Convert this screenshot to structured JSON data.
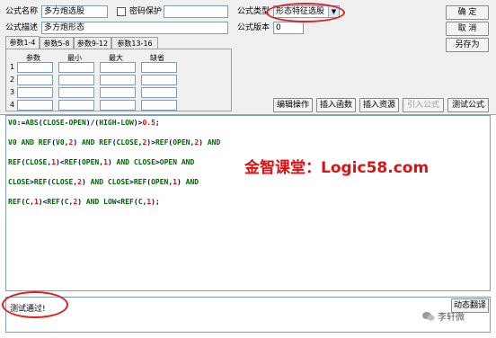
{
  "form": {
    "name_label": "公式名称",
    "name_value": "多方炮选股",
    "password_label": "密码保护",
    "desc_label": "公式描述",
    "desc_value": "多方炮形态",
    "type_label": "公式类型",
    "type_value": "形态特征选股",
    "version_label": "公式版本",
    "version_value": "0"
  },
  "buttons": {
    "ok": "确  定",
    "cancel": "取  消",
    "save_as": "另存为",
    "edit_ops": "编辑操作",
    "insert_func": "插入函数",
    "insert_res": "插入资源",
    "import_formula": "引入公式",
    "test_formula": "测试公式",
    "dynamic_translate": "动态翻译"
  },
  "params": {
    "tabs": [
      "参数1-4",
      "参数5-8",
      "参数9-12",
      "参数13-16"
    ],
    "headers": [
      "参数",
      "最小",
      "最大",
      "缺省"
    ],
    "rows": [
      "1",
      "2",
      "3",
      "4"
    ]
  },
  "code": {
    "lines": [
      "V0:=ABS(CLOSE-OPEN)/(HIGH-LOW)>0.5;",
      "V0 AND REF(V0,2) AND REF(CLOSE,2)>REF(OPEN,2) AND",
      "REF(CLOSE,1)<REF(OPEN,1) AND CLOSE>OPEN AND",
      "CLOSE>REF(CLOSE,2) AND CLOSE>REF(OPEN,1) AND",
      "REF(C,1)<REF(C,2) AND LOW<REF(C,1);"
    ]
  },
  "watermark": "金智课堂：Logic58.com",
  "status": "测试通过!",
  "wechat_label": "李轩微",
  "colors": {
    "keyword": "#006400",
    "operator": "#00008b",
    "number": "#ff0000",
    "annotation": "#e02020"
  }
}
